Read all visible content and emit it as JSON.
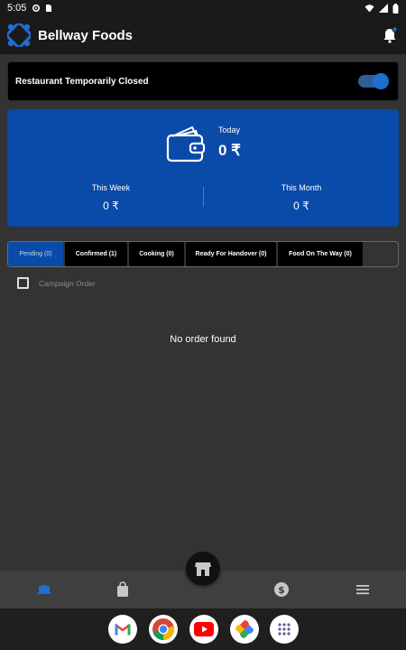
{
  "statusbar": {
    "time": "5:05"
  },
  "appbar": {
    "title": "Bellway Foods"
  },
  "restaurant_status": {
    "label": "Restaurant Temporarily Closed",
    "toggle_on": true
  },
  "earnings": {
    "today_label": "Today",
    "today_value": "0 ₹",
    "week_label": "This Week",
    "week_value": "0 ₹",
    "month_label": "This Month",
    "month_value": "0 ₹"
  },
  "tabs": [
    {
      "label": "Pending (0)",
      "active": true
    },
    {
      "label": "Confirmed (1)",
      "active": false
    },
    {
      "label": "Cooking (0)",
      "active": false
    },
    {
      "label": "Ready For Handover (0)",
      "active": false
    },
    {
      "label": "Food On The Way (0)",
      "active": false
    }
  ],
  "campaign": {
    "label": "Campaign Order",
    "checked": false
  },
  "empty_state": "No order found",
  "bottom_nav": [
    "home-icon",
    "bag-icon",
    "store-icon",
    "dollar-icon",
    "menu-icon"
  ],
  "dock": [
    "gmail-icon",
    "chrome-icon",
    "youtube-icon",
    "photos-icon",
    "app-drawer-icon"
  ],
  "colors": {
    "primary": "#0a4aa8",
    "background": "#333333",
    "bar": "#1a1a1a"
  }
}
